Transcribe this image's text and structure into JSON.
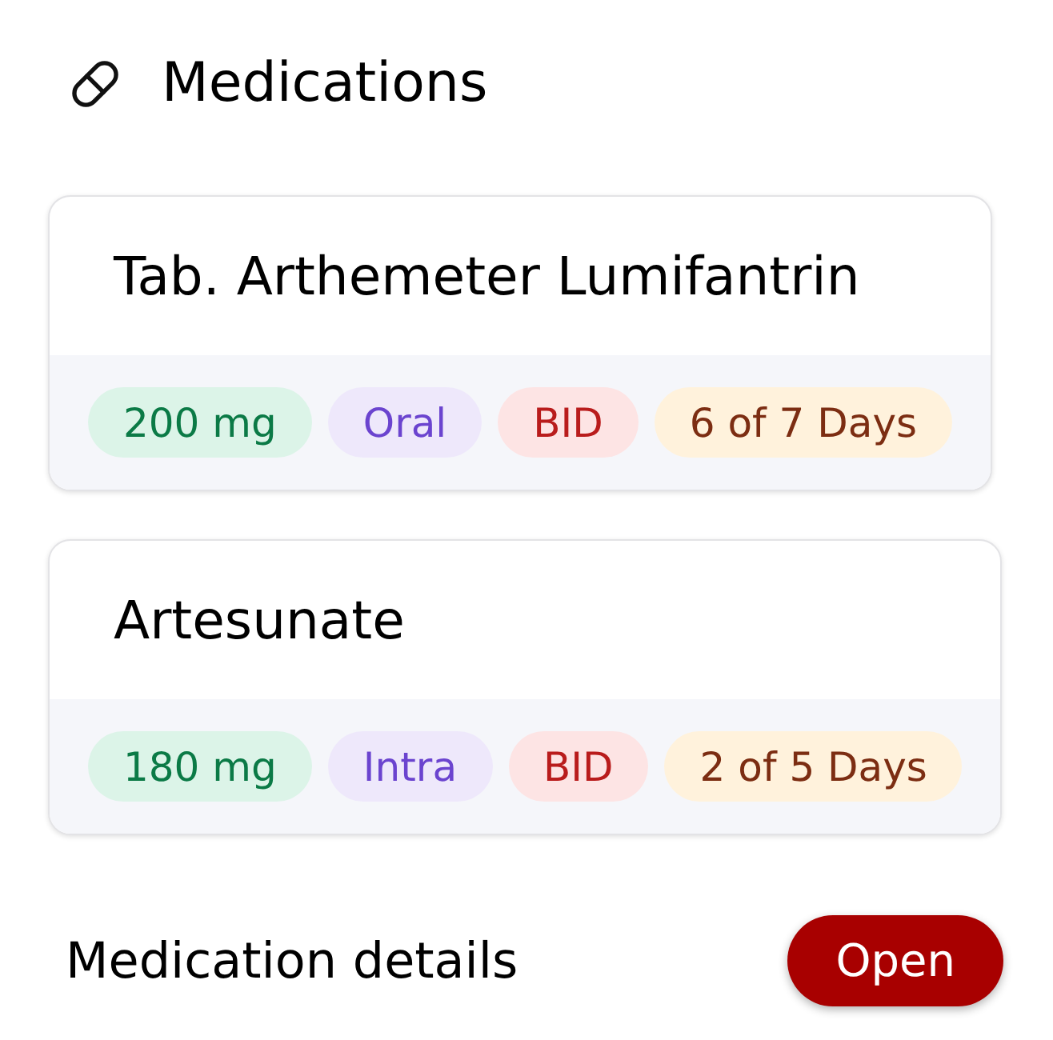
{
  "header": {
    "title": "Medications"
  },
  "medications": [
    {
      "name": "Tab. Arthemeter Lumifantrin",
      "chips": [
        {
          "kind": "dose",
          "text": "200 mg"
        },
        {
          "kind": "route",
          "text": "Oral"
        },
        {
          "kind": "frequency",
          "text": "BID"
        },
        {
          "kind": "duration",
          "text": "6 of 7 Days"
        }
      ]
    },
    {
      "name": "Artesunate",
      "chips": [
        {
          "kind": "dose",
          "text": "180 mg"
        },
        {
          "kind": "route",
          "text": "Intra"
        },
        {
          "kind": "frequency",
          "text": "BID"
        },
        {
          "kind": "duration",
          "text": "2 of 5 Days"
        }
      ]
    }
  ],
  "footer": {
    "label": "Medication details",
    "button": "Open"
  }
}
